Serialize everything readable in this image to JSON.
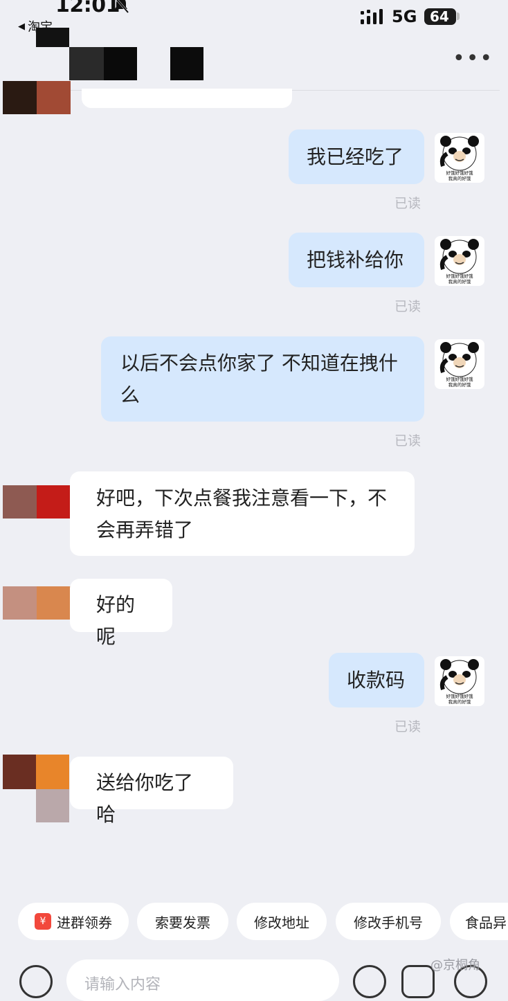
{
  "status_bar": {
    "time": "12:01",
    "network": "5G",
    "battery": "64",
    "back_app": "淘宝"
  },
  "header": {
    "more": "•••"
  },
  "messages": [
    {
      "side": "me",
      "text_lines": [
        "我已经吃了"
      ],
      "read": "已读"
    },
    {
      "side": "me",
      "text_lines": [
        "把钱补给你"
      ],
      "read": "已读"
    },
    {
      "side": "me",
      "text_lines": [
        "以后不会点你家了 不知道在拽什",
        "么"
      ],
      "read": "已读"
    },
    {
      "side": "them",
      "text_lines": [
        "好吧，下次点餐我注意看一下，不",
        "会再弄错了"
      ]
    },
    {
      "side": "them",
      "text_lines": [
        "好的呢"
      ]
    },
    {
      "side": "me",
      "text_lines": [
        "收款码"
      ],
      "read": "已读"
    },
    {
      "side": "them",
      "text_lines": [
        "送给你吃了哈"
      ]
    }
  ],
  "quick_replies": [
    "进群领券",
    "索要发票",
    "修改地址",
    "修改手机号",
    "食品异"
  ],
  "quick_reply_icon": "yuan-coupon-icon",
  "input": {
    "placeholder": "请输入内容"
  },
  "watermark": "@京桐角",
  "sticker_caption": [
    "好饿好饿好饿",
    "我真的好饿"
  ],
  "colors": {
    "background": "#eeeff4",
    "my_bubble": "#d6e8fd",
    "their_bubble": "#ffffff",
    "read_text": "#b7b8bf"
  }
}
